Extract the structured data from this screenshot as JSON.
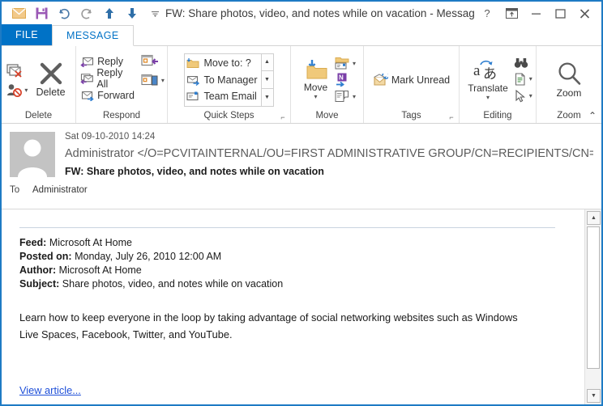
{
  "window": {
    "title": "FW: Share photos, video, and notes while on vacation - Message (HTML)",
    "accent_color": "#0072c6",
    "border_color": "#1e7bc4"
  },
  "quick_access_toolbar": {
    "items": [
      {
        "name": "mail-icon",
        "label": "Mail"
      },
      {
        "name": "save-icon",
        "label": "Save"
      },
      {
        "name": "undo-icon",
        "label": "Undo"
      },
      {
        "name": "redo-icon",
        "label": "Redo"
      },
      {
        "name": "previous-item-icon",
        "label": "Previous Item"
      },
      {
        "name": "next-item-icon",
        "label": "Next Item"
      },
      {
        "name": "customize-qat-icon",
        "label": "Customize Quick Access Toolbar"
      }
    ]
  },
  "window_controls": {
    "help": "?",
    "ribbon_display_options": "Ribbon Display Options",
    "minimize": "Minimize",
    "maximize": "Maximize",
    "close": "Close"
  },
  "tabs": [
    {
      "label": "FILE",
      "active": false,
      "kind": "file"
    },
    {
      "label": "MESSAGE",
      "active": true,
      "kind": "normal"
    }
  ],
  "ribbon": {
    "groups": [
      {
        "label": "Delete",
        "has_dialog_launcher": false,
        "buttons": [
          {
            "label": "Ignore",
            "icon": "ignore-icon"
          },
          {
            "label": "Junk",
            "icon": "junk-icon",
            "has_caret": true
          },
          {
            "label": "Delete",
            "icon": "delete-icon"
          }
        ]
      },
      {
        "label": "Respond",
        "has_dialog_launcher": false,
        "buttons": [
          {
            "label": "Reply",
            "icon": "reply-icon"
          },
          {
            "label": "Reply All",
            "icon": "reply-all-icon"
          },
          {
            "label": "Forward",
            "icon": "forward-icon"
          },
          {
            "label": "Meeting",
            "icon": "meeting-icon"
          },
          {
            "label": "More",
            "icon": "more-respond-icon",
            "has_caret": true
          }
        ]
      },
      {
        "label": "Quick Steps",
        "has_dialog_launcher": true,
        "quick_steps": [
          {
            "label": "Move to: ?",
            "icon": "move-to-folder-icon"
          },
          {
            "label": "To Manager",
            "icon": "to-manager-icon"
          },
          {
            "label": "Team Email",
            "icon": "team-email-icon"
          }
        ],
        "scroll_buttons": [
          "scroll-up-icon",
          "scroll-down-icon",
          "more-quick-steps-icon"
        ]
      },
      {
        "label": "Move",
        "has_dialog_launcher": false,
        "buttons": [
          {
            "label": "Move",
            "icon": "move-icon",
            "has_caret": true
          },
          {
            "label": "Rules",
            "icon": "rules-icon",
            "has_caret": true
          },
          {
            "label": "OneNote",
            "icon": "onenote-icon"
          },
          {
            "label": "Actions",
            "icon": "actions-icon",
            "has_caret": true
          }
        ]
      },
      {
        "label": "Tags",
        "has_dialog_launcher": true,
        "buttons": [
          {
            "label": "Mark Unread",
            "icon": "mark-unread-icon"
          }
        ]
      },
      {
        "label": "Editing",
        "has_dialog_launcher": false,
        "buttons": [
          {
            "label": "Translate",
            "icon": "translate-icon",
            "has_caret": true
          },
          {
            "label": "Find",
            "icon": "find-binoculars-icon"
          },
          {
            "label": "Related",
            "icon": "related-document-icon",
            "has_caret": true
          },
          {
            "label": "Select",
            "icon": "select-pointer-icon",
            "has_caret": true
          }
        ]
      },
      {
        "label": "Zoom",
        "has_dialog_launcher": false,
        "buttons": [
          {
            "label": "Zoom",
            "icon": "zoom-magnifier-icon"
          }
        ]
      }
    ],
    "collapse_ribbon": "collapse-ribbon-icon"
  },
  "message_header": {
    "date": "Sat 09-10-2010 14:24",
    "sender": "Administrator </O=PCVITAINTERNAL/OU=FIRST ADMINISTRATIVE GROUP/CN=RECIPIENTS/CN=AD",
    "subject": "FW: Share photos, video, and notes while on vacation",
    "to_label": "To",
    "to_value": "Administrator",
    "avatar": "contact-photo-placeholder"
  },
  "message_body": {
    "meta": [
      {
        "label": "Feed:",
        "value": "Microsoft At Home"
      },
      {
        "label": "Posted on:",
        "value": "Monday, July 26, 2010 12:00 AM"
      },
      {
        "label": "Author:",
        "value": "Microsoft At Home"
      },
      {
        "label": "Subject:",
        "value": "Share photos, video, and notes while on vacation"
      }
    ],
    "paragraph": "Learn how to keep everyone in the loop by taking advantage of social networking websites such as Windows Live Spaces, Facebook, Twitter, and YouTube.",
    "link_text": "View article...",
    "link_color": "#1e4fd8"
  },
  "scrollbar": {
    "up_arrow": "scroll-up-arrow",
    "down_arrow": "scroll-down-arrow",
    "thumb": "scroll-thumb"
  }
}
